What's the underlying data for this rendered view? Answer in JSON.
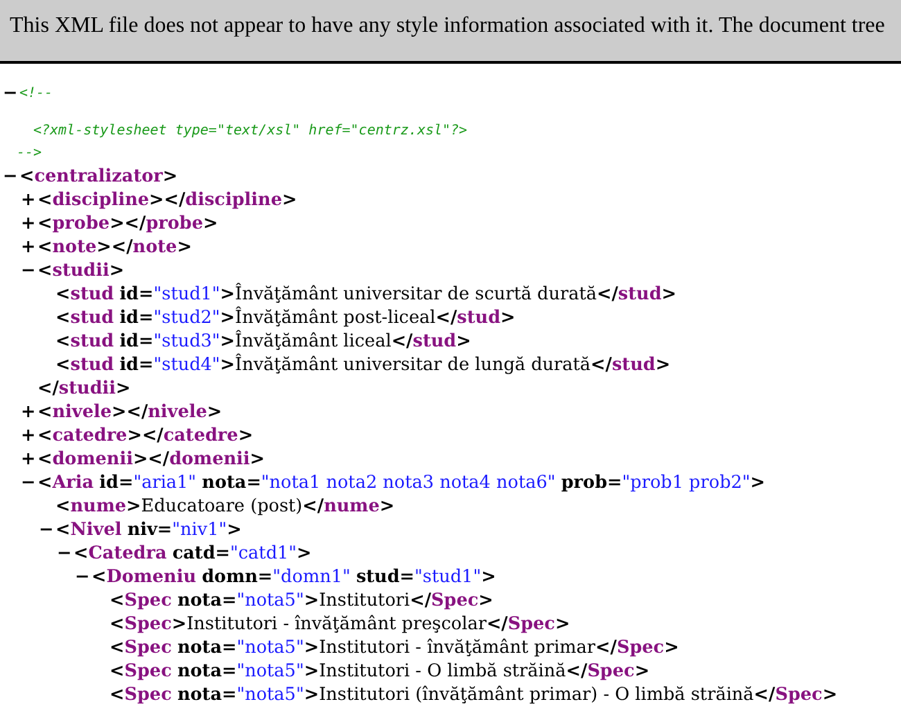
{
  "banner": {
    "text": "This XML file does not appear to have any style information associated with it. The document tree"
  },
  "syntax": {
    "lt": "<",
    "gt": ">",
    "close_lt": "</",
    "eq": "=",
    "quote": "\"",
    "expanded_mark": "−",
    "collapsed_mark": "+"
  },
  "comment": {
    "expanded": true,
    "open": "<!--",
    "lines": [
      "<?xml-stylesheet type=\"text/xsl\" href=\"centrz.xsl\"?>"
    ],
    "close": "-->"
  },
  "root": {
    "tag": "centralizator",
    "expanded": true,
    "children": [
      {
        "tag": "discipline",
        "expanded": false,
        "close_tag": "discipline"
      },
      {
        "tag": "probe",
        "expanded": false,
        "close_tag": "probe"
      },
      {
        "tag": "note",
        "expanded": false,
        "close_tag": "note"
      },
      {
        "tag": "studii",
        "expanded": true,
        "close_tag": "studii",
        "children": [
          {
            "tag": "stud",
            "attrs": [
              {
                "name": "id",
                "value": "stud1"
              }
            ],
            "text": "Învăţământ universitar de scurtă durată",
            "close_tag": "stud"
          },
          {
            "tag": "stud",
            "attrs": [
              {
                "name": "id",
                "value": "stud2"
              }
            ],
            "text": "Învăţământ post-liceal",
            "close_tag": "stud"
          },
          {
            "tag": "stud",
            "attrs": [
              {
                "name": "id",
                "value": "stud3"
              }
            ],
            "text": "Învăţământ liceal",
            "close_tag": "stud"
          },
          {
            "tag": "stud",
            "attrs": [
              {
                "name": "id",
                "value": "stud4"
              }
            ],
            "text": "Învăţământ universitar de lungă durată",
            "close_tag": "stud"
          }
        ]
      },
      {
        "tag": "nivele",
        "expanded": false,
        "close_tag": "nivele"
      },
      {
        "tag": "catedre",
        "expanded": false,
        "close_tag": "catedre"
      },
      {
        "tag": "domenii",
        "expanded": false,
        "close_tag": "domenii"
      },
      {
        "tag": "Aria",
        "attrs": [
          {
            "name": "id",
            "value": "aria1"
          },
          {
            "name": "nota",
            "value": "nota1 nota2 nota3 nota4 nota6"
          },
          {
            "name": "prob",
            "value": "prob1 prob2"
          }
        ],
        "expanded": true,
        "children": [
          {
            "tag": "nume",
            "text": "Educatoare (post)",
            "close_tag": "nume"
          },
          {
            "tag": "Nivel",
            "attrs": [
              {
                "name": "niv",
                "value": "niv1"
              }
            ],
            "expanded": true,
            "children": [
              {
                "tag": "Catedra",
                "attrs": [
                  {
                    "name": "catd",
                    "value": "catd1"
                  }
                ],
                "expanded": true,
                "children": [
                  {
                    "tag": "Domeniu",
                    "attrs": [
                      {
                        "name": "domn",
                        "value": "domn1"
                      },
                      {
                        "name": "stud",
                        "value": "stud1"
                      }
                    ],
                    "expanded": true,
                    "children": [
                      {
                        "tag": "Spec",
                        "attrs": [
                          {
                            "name": "nota",
                            "value": "nota5"
                          }
                        ],
                        "text": "Institutori",
                        "close_tag": "Spec"
                      },
                      {
                        "tag": "Spec",
                        "text": "Institutori - învăţământ preşcolar",
                        "close_tag": "Spec"
                      },
                      {
                        "tag": "Spec",
                        "attrs": [
                          {
                            "name": "nota",
                            "value": "nota5"
                          }
                        ],
                        "text": "Institutori - învăţământ primar",
                        "close_tag": "Spec"
                      },
                      {
                        "tag": "Spec",
                        "attrs": [
                          {
                            "name": "nota",
                            "value": "nota5"
                          }
                        ],
                        "text": "Institutori - O limbă străină",
                        "close_tag": "Spec"
                      },
                      {
                        "tag": "Spec",
                        "attrs": [
                          {
                            "name": "nota",
                            "value": "nota5"
                          }
                        ],
                        "text": "Institutori (învăţământ primar) - O limbă străină",
                        "close_tag": "Spec"
                      }
                    ]
                  }
                ]
              }
            ]
          }
        ]
      }
    ]
  }
}
